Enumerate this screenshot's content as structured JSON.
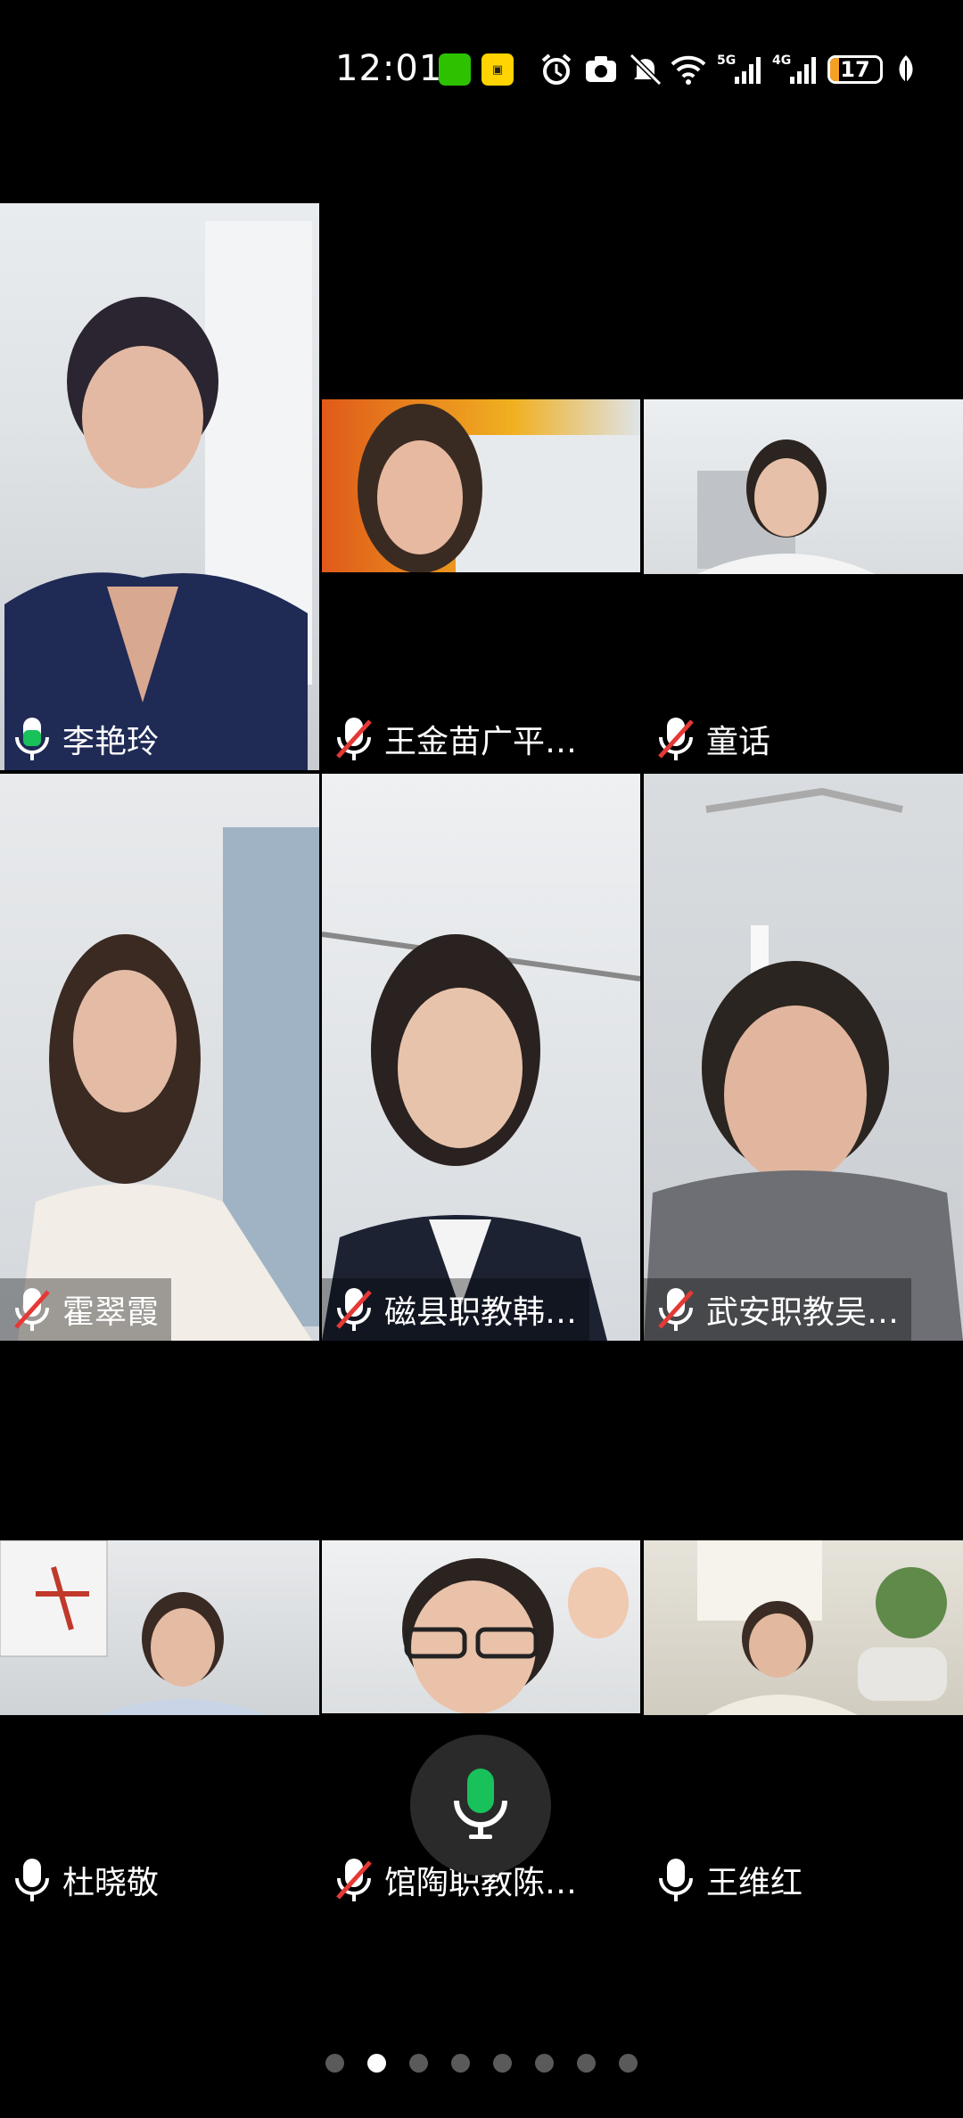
{
  "status_bar": {
    "time": "12:01",
    "battery_level": "17",
    "network_labels": [
      "5G",
      "4G"
    ],
    "icons": [
      "wechat-icon",
      "app-badge-icon",
      "alarm-icon",
      "camera-icon",
      "mute-icon",
      "wifi-icon",
      "signal-icon",
      "battery-icon",
      "leaf-icon"
    ]
  },
  "participants": [
    {
      "name": "李艳玲",
      "mic": "active"
    },
    {
      "name": "王金苗广平…",
      "mic": "muted"
    },
    {
      "name": "童话",
      "mic": "muted"
    },
    {
      "name": "霍翠霞",
      "mic": "muted"
    },
    {
      "name": "磁县职教韩…",
      "mic": "muted"
    },
    {
      "name": "武安职教吴…",
      "mic": "muted"
    },
    {
      "name": "杜晓敬",
      "mic": "on"
    },
    {
      "name": "馆陶职教陈…",
      "mic": "muted"
    },
    {
      "name": "王维红",
      "mic": "on"
    }
  ],
  "floating_mic": {
    "state": "on",
    "color": "#19c15a"
  },
  "pagination": {
    "count": 8,
    "active_index": 1
  },
  "colors": {
    "active_speaker": "#19c15a",
    "muted_slash": "#e53935",
    "battery": "#f4a024"
  }
}
